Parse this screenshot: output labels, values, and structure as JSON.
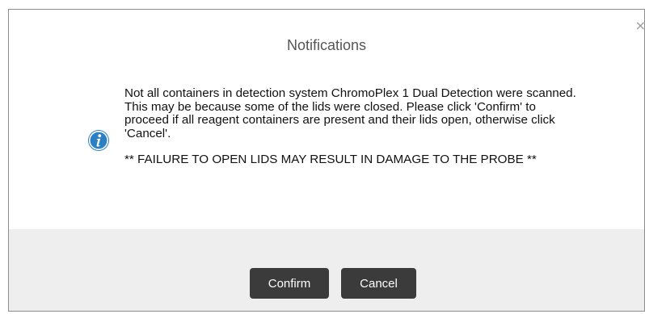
{
  "dialog": {
    "title": "Notifications",
    "close_glyph": "×",
    "icon": "info-icon",
    "message": "Not all containers in detection system ChromoPlex 1 Dual Detection were scanned. This may be because some of the lids were closed. Please click 'Confirm' to proceed if all reagent containers are present and their lids open, otherwise click 'Cancel'.",
    "warning": "** FAILURE TO OPEN LIDS MAY RESULT IN DAMAGE TO THE PROBE **",
    "buttons": {
      "confirm_label": "Confirm",
      "cancel_label": "Cancel"
    }
  },
  "colors": {
    "icon_blue": "#2c7fc3",
    "button_bg": "#3b3b3b",
    "footer_bg": "#eeeeee"
  }
}
